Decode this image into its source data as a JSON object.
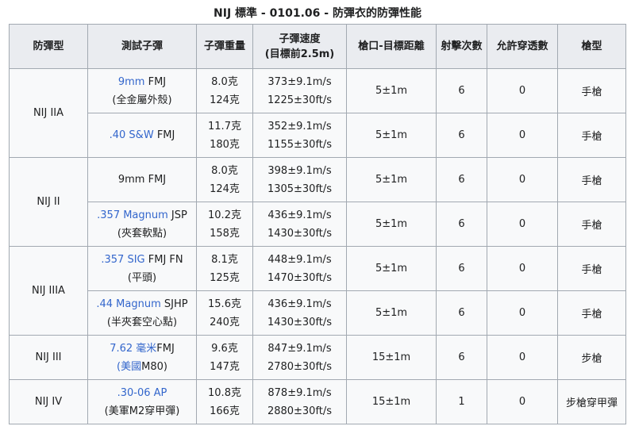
{
  "caption": "NIJ 標準 - 0101.06 - 防彈衣的防彈性能",
  "headers": {
    "armor_type": "防彈型",
    "bullet": "測試子彈",
    "weight": "子彈重量",
    "velocity_line1": "子彈速度",
    "velocity_line2": "(目標前2.5m)",
    "distance": "槍口-目標距離",
    "shots": "射擊次數",
    "penetrations": "允許穿透數",
    "gun": "槍型"
  },
  "groups": [
    {
      "level": "NIJ IIA",
      "rows": [
        {
          "bullet_link": "9mm",
          "bullet_rest": " FMJ",
          "bullet_sub": "(全金屬外殼)",
          "weight_g": "8.0克",
          "weight_gr": "124克",
          "vel_ms": "373±9.1m/s",
          "vel_fts": "1225±30ft/s",
          "distance": "5±1m",
          "shots": "6",
          "pen": "0",
          "gun": "手槍"
        },
        {
          "bullet_link": ".40 S&W",
          "bullet_rest": " FMJ",
          "bullet_sub": "",
          "weight_g": "11.7克",
          "weight_gr": "180克",
          "vel_ms": "352±9.1m/s",
          "vel_fts": "1155±30ft/s",
          "distance": "5±1m",
          "shots": "6",
          "pen": "0",
          "gun": "手槍"
        }
      ]
    },
    {
      "level": "NIJ II",
      "rows": [
        {
          "bullet_link": "",
          "bullet_rest": "9mm FMJ",
          "bullet_sub": "",
          "weight_g": "8.0克",
          "weight_gr": "124克",
          "vel_ms": "398±9.1m/s",
          "vel_fts": "1305±30ft/s",
          "distance": "5±1m",
          "shots": "6",
          "pen": "0",
          "gun": "手槍"
        },
        {
          "bullet_link": ".357 Magnum",
          "bullet_rest": " JSP",
          "bullet_sub": "(夾套軟點)",
          "weight_g": "10.2克",
          "weight_gr": "158克",
          "vel_ms": "436±9.1m/s",
          "vel_fts": "1430±30ft/s",
          "distance": "5±1m",
          "shots": "6",
          "pen": "0",
          "gun": "手槍"
        }
      ]
    },
    {
      "level": "NIJ IIIA",
      "rows": [
        {
          "bullet_link": ".357 SIG",
          "bullet_rest": " FMJ FN",
          "bullet_sub": "(平頭)",
          "weight_g": "8.1克",
          "weight_gr": "125克",
          "vel_ms": "448±9.1m/s",
          "vel_fts": "1470±30ft/s",
          "distance": "5±1m",
          "shots": "6",
          "pen": "0",
          "gun": "手槍"
        },
        {
          "bullet_link": ".44 Magnum",
          "bullet_rest": " SJHP",
          "bullet_sub": "(半夾套空心點)",
          "weight_g": "15.6克",
          "weight_gr": "240克",
          "vel_ms": "436±9.1m/s",
          "vel_fts": "1430±30ft/s",
          "distance": "5±1m",
          "shots": "6",
          "pen": "0",
          "gun": "手槍"
        }
      ]
    },
    {
      "level": "NIJ III",
      "rows": [
        {
          "bullet_link": "7.62 毫米",
          "bullet_rest": "FMJ",
          "bullet_sub_link": "(美國",
          "bullet_sub": "M80)",
          "weight_g": "9.6克",
          "weight_gr": "147克",
          "vel_ms": "847±9.1m/s",
          "vel_fts": "2780±30ft/s",
          "distance": "15±1m",
          "shots": "6",
          "pen": "0",
          "gun": "步槍"
        }
      ]
    },
    {
      "level": "NIJ IV",
      "rows": [
        {
          "bullet_link": ".30-06 AP",
          "bullet_rest": "",
          "bullet_sub": "(美軍M2穿甲彈)",
          "weight_g": "10.8克",
          "weight_gr": "166克",
          "vel_ms": "878±9.1m/s",
          "vel_fts": "2880±30ft/s",
          "distance": "15±1m",
          "shots": "1",
          "pen": "0",
          "gun": "步槍穿甲彈"
        }
      ]
    }
  ]
}
